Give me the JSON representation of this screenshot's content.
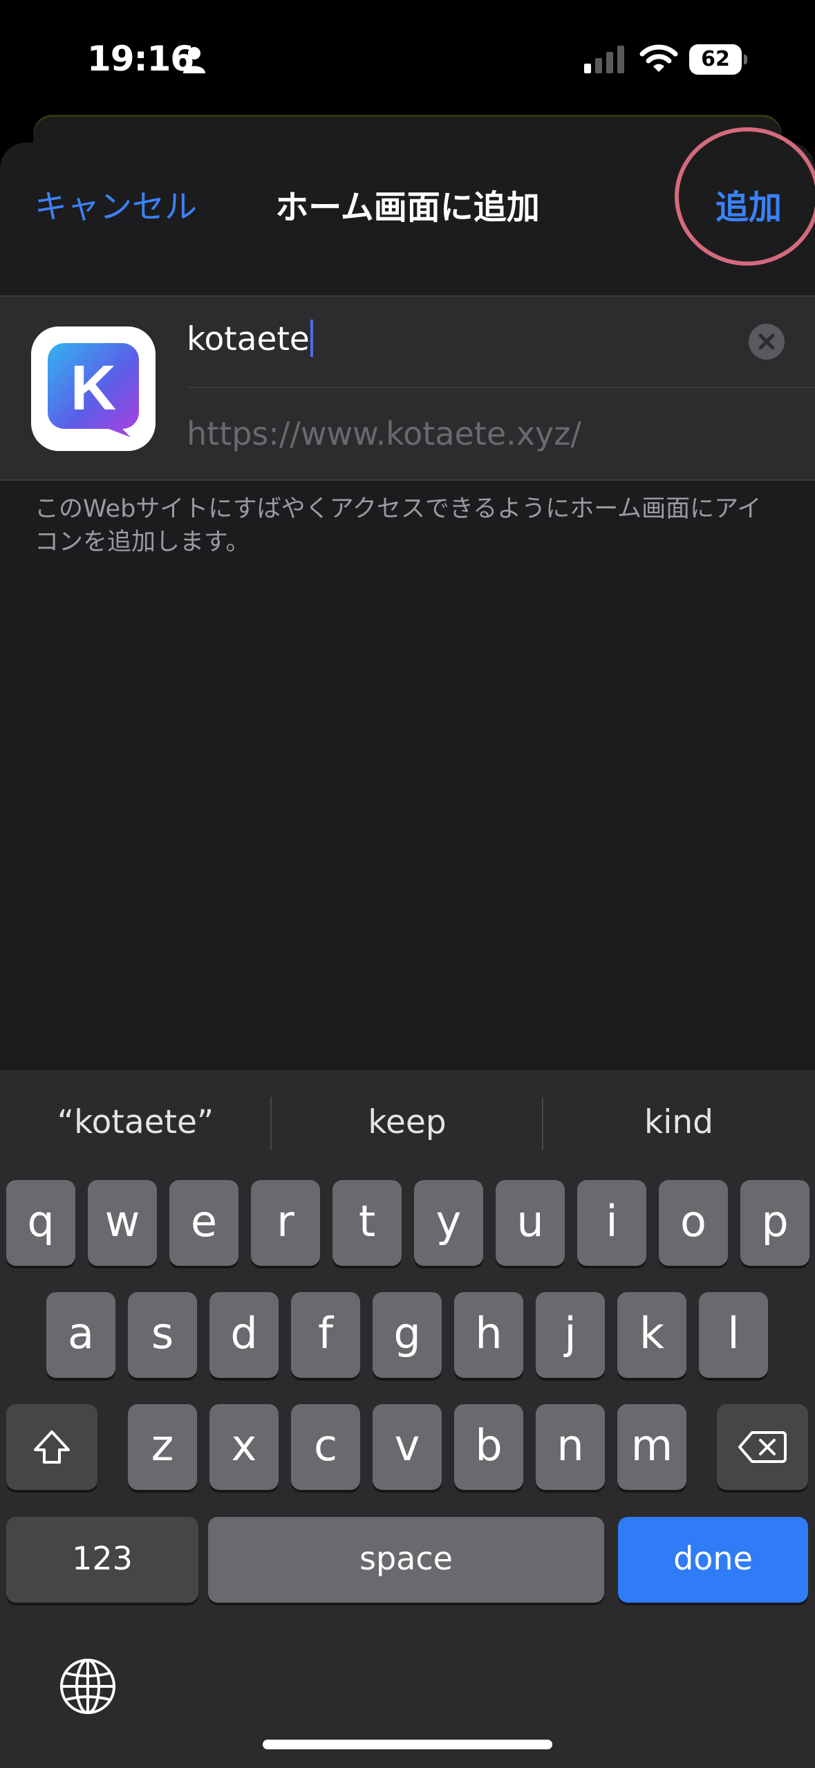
{
  "status_bar": {
    "time": "19:16",
    "battery": "62"
  },
  "sheet": {
    "cancel_label": "キャンセル",
    "title": "ホーム画面に追加",
    "add_label": "追加"
  },
  "entry": {
    "app_icon_letter": "K",
    "name_value": "kotaete",
    "url": "https://www.kotaete.xyz/"
  },
  "description": "このWebサイトにすばやくアクセスできるようにホーム画面にアイコンを追加します。",
  "keyboard": {
    "suggestions": [
      "“kotaete”",
      "keep",
      "kind"
    ],
    "row1": [
      "q",
      "w",
      "e",
      "r",
      "t",
      "y",
      "u",
      "i",
      "o",
      "p"
    ],
    "row2": [
      "a",
      "s",
      "d",
      "f",
      "g",
      "h",
      "j",
      "k",
      "l"
    ],
    "row3": [
      "z",
      "x",
      "c",
      "v",
      "b",
      "n",
      "m"
    ],
    "numbers_label": "123",
    "space_label": "space",
    "done_label": "done"
  },
  "colors": {
    "accent": "#3b82f6",
    "done_key": "#2f7cf6",
    "highlight_ring": "#d46a7e"
  },
  "icons": [
    "person-icon",
    "cellular-signal-icon",
    "wifi-icon",
    "battery-icon",
    "clear-text-icon",
    "shift-icon",
    "delete-icon",
    "globe-icon"
  ]
}
